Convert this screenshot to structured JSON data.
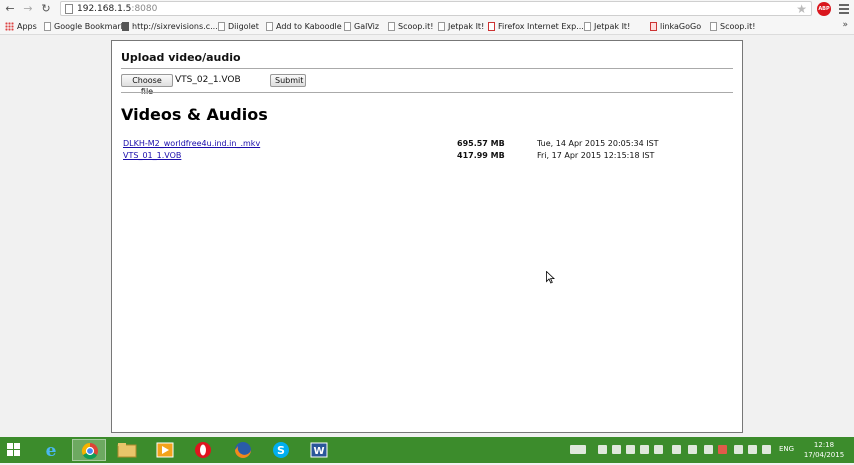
{
  "browser": {
    "url_host": "192.168.1.5",
    "url_port": ":8080",
    "abp_label": "ABP"
  },
  "bookmarks": [
    {
      "label": "Apps"
    },
    {
      "label": "Google Bookmark"
    },
    {
      "label": "http://sixrevisions.c..."
    },
    {
      "label": "Diigolet"
    },
    {
      "label": "Add to Kaboodle"
    },
    {
      "label": "GalViz"
    },
    {
      "label": "Scoop.it!"
    },
    {
      "label": "Jetpak It!"
    },
    {
      "label": "Firefox Internet Exp..."
    },
    {
      "label": "Jetpak It!"
    },
    {
      "label": "linkaGoGo"
    },
    {
      "label": "Scoop.it!"
    }
  ],
  "bookmarks_overflow": "»",
  "upload": {
    "title": "Upload video/audio",
    "choose_label": "Choose file",
    "file_name": "VTS_02_1.VOB",
    "submit_label": "Submit"
  },
  "list": {
    "heading": "Videos & Audios",
    "items": [
      {
        "name": "DLKH-M2_worldfree4u.ind.in_.mkv",
        "size": "695.57 MB",
        "date": "Tue, 14 Apr 2015 20:05:34 IST"
      },
      {
        "name": "VTS_01_1.VOB",
        "size": "417.99 MB",
        "date": "Fri, 17 Apr 2015 12:15:18 IST"
      }
    ]
  },
  "taskbar": {
    "lang": "ENG",
    "time": "12:18",
    "date": "17/04/2015"
  },
  "colors": {
    "link": "#1a0dab",
    "taskbar": "#3c8c2c",
    "abp": "#d9161d"
  }
}
